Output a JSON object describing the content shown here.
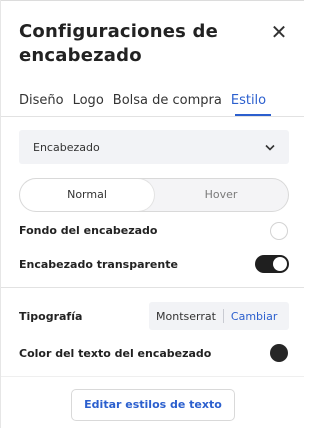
{
  "header": {
    "title": "Configuraciones de encabezado",
    "close_icon": "close-icon"
  },
  "tabs": [
    {
      "label": "Diseño",
      "active": false
    },
    {
      "label": "Logo",
      "active": false
    },
    {
      "label": "Bolsa de compra",
      "active": false
    },
    {
      "label": "Estilo",
      "active": true
    }
  ],
  "section_select": {
    "value": "Encabezado",
    "icon": "chevron-down-icon"
  },
  "state_toggle": {
    "options": [
      "Normal",
      "Hover"
    ],
    "selected": "Normal"
  },
  "header_background": {
    "label": "Fondo del encabezado",
    "color": "#ffffff"
  },
  "transparent_header": {
    "label": "Encabezado transparente",
    "on": true
  },
  "typography": {
    "label": "Tipografía",
    "font": "Montserrat",
    "change_label": "Cambiar"
  },
  "text_color": {
    "label": "Color del texto del encabezado",
    "color": "#262626"
  },
  "edit_button": {
    "label": "Editar estilos de texto"
  },
  "colors": {
    "accent": "#2b5fce",
    "toggle_on": "#1f1f1f"
  }
}
